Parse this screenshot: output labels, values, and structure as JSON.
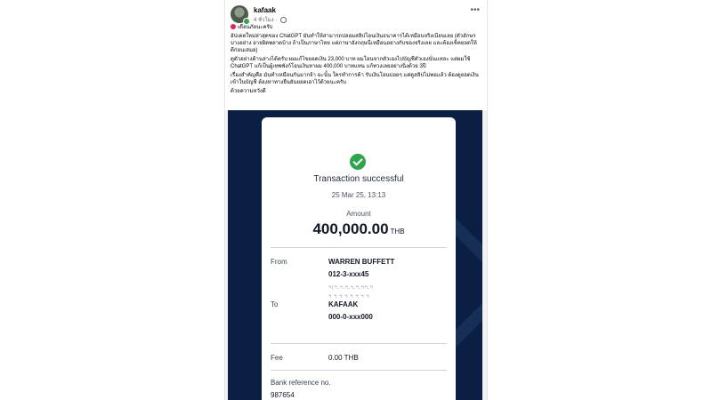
{
  "post": {
    "author": "kafaak",
    "time": "4 ชั่วโมง",
    "paragraphs": [
      "เตือนภัยนะครับ",
      "อัปเดตใหม่ล่าสุดของ ChatGPT มันทำให้สามารถปลอมสลิปโอนเงินธนาคารได้เหมือนจริงเนียนเลย (ตัวอักษรบางอย่าง อาจผิดพลาดบ้าง ถ้าเป็นภาษาไทย แต่ภาษาอังกฤษนี่เหมือนอย่างกับของจริงเลย และต้องเช็คยอดให้ดีก่อนเสมอ)",
      "ดูตัวอย่างด้านล่างได้ครับ ผมแก้ไขยอดเงิน 23,000 บาท ผมโอนจากตัวเองไปบัญชีตัวเองนั่นแหละ แต่ผมใช้ ChatGPT แก้เป็นผู้เทพพังก์โอนเงินหาผม 400,000 บาทแทน แก้ทวงเลยอย่างนิ่งด้วย 3ปี",
      "เรื่องสำคัญคือ มันทำเหมือนกันมากจ้า ฉะนั้น ใครทำการค้า รับเงินโอนบ่อยๆ แค่ดูสลิปไม่พอแล้ว ต้องดูยอดเงินเข้าในบัญชี ต้องหาทางยืนยันยอดเอาไว้ด้วยนะครับ",
      "ด้วยความหวังดี"
    ]
  },
  "receipt": {
    "title": "Transaction successful",
    "date": "25 Mar 25, 13:13",
    "amount_label": "Amount",
    "amount": "400,000.00",
    "currency": "THB",
    "from_label": "From",
    "from_name": "WARREN BUFFETT",
    "from_account": "012-3-xxx45",
    "from_blur_1": "ฯ(ฯ.ฯ.ฯ,ฯ,ฯ,ฯฯ,ฯ",
    "from_blur_2": "ฯ ฯ ฯ ฯ ฯ ฯ ฯ ฯ",
    "to_label": "To",
    "to_name": "KAFAAK",
    "to_account": "000-0-xxx000",
    "fee_label": "Fee",
    "fee_value": "0.00 THB",
    "ref_label": "Bank reference no.",
    "ref_value": "987654"
  },
  "colors": {
    "success": "#2da44e",
    "panel_bg": "#0b1f45",
    "alert": "#e0245e"
  }
}
